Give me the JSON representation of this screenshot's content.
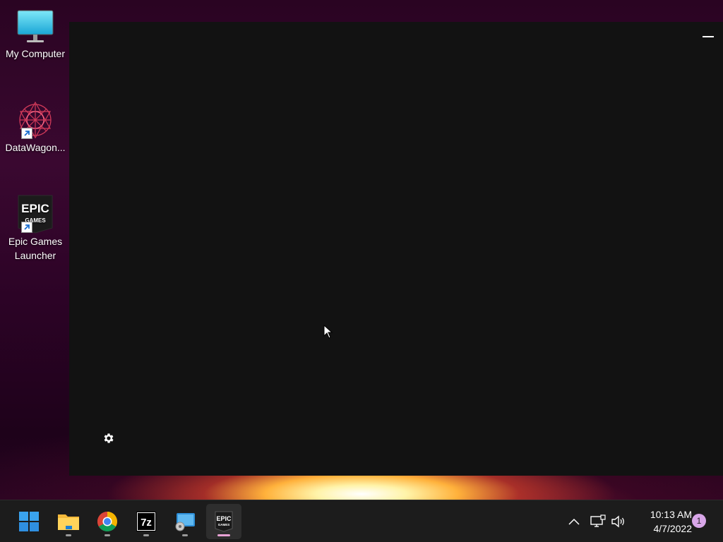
{
  "desktop": {
    "icons": [
      {
        "label": "My Computer",
        "icon": "monitor-icon"
      },
      {
        "label": "DataWagon...",
        "icon": "datawagon-icon"
      },
      {
        "label": "Epic Games Launcher",
        "icon": "epic-games-icon"
      }
    ]
  },
  "launcher_window": {
    "background": "#121212",
    "controls": {
      "minimize": "minimize-icon",
      "settings": "gear-icon"
    }
  },
  "taskbar": {
    "apps": [
      {
        "name": "start",
        "icon": "windows-logo-icon"
      },
      {
        "name": "file-explorer",
        "icon": "folder-icon"
      },
      {
        "name": "chrome",
        "icon": "chrome-icon"
      },
      {
        "name": "7zip",
        "icon": "7zip-icon",
        "text": "7z"
      },
      {
        "name": "remote-desktop",
        "icon": "remote-desktop-icon"
      },
      {
        "name": "epic-games",
        "icon": "epic-games-icon",
        "text": "EPIC",
        "subtext": "GAMES"
      }
    ],
    "tray": {
      "icons": [
        "chevron-up-icon",
        "network-icon",
        "speaker-icon"
      ],
      "time": "10:13 AM",
      "date": "4/7/2022",
      "notification_count": "1"
    },
    "accent": "#e9a3d6"
  }
}
